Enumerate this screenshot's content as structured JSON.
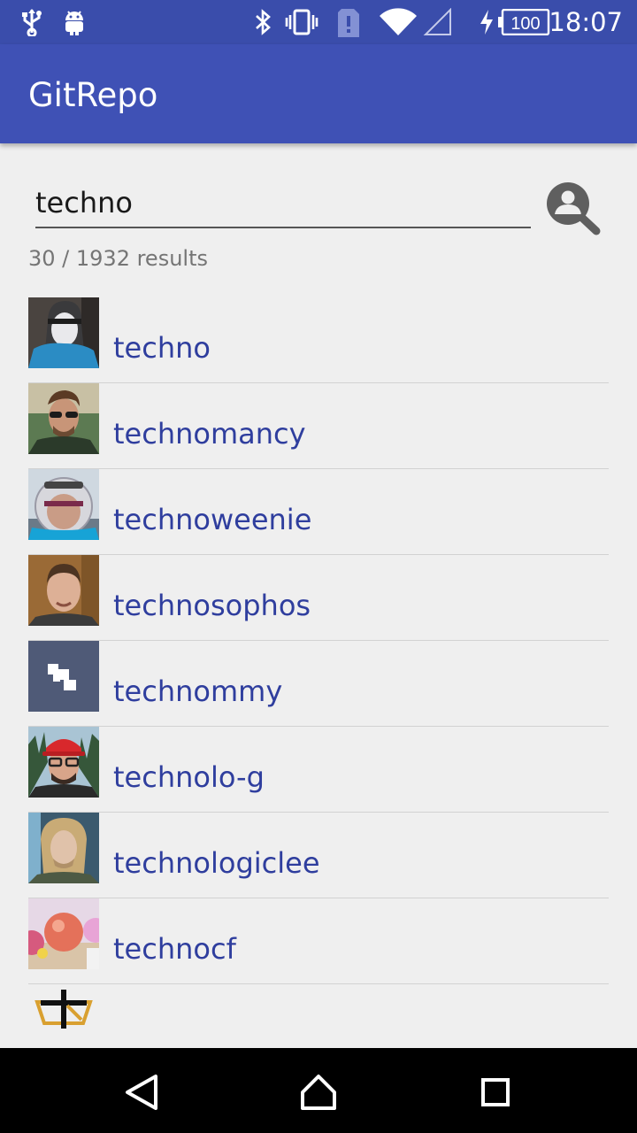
{
  "status_bar": {
    "battery": "100",
    "time": "18:07"
  },
  "app_bar": {
    "title": "GitRepo"
  },
  "search": {
    "query": "techno",
    "icon": "search-user-icon"
  },
  "results": {
    "count_text": "30 / 1932 results",
    "items": [
      {
        "login": "techno"
      },
      {
        "login": "technomancy"
      },
      {
        "login": "technoweenie"
      },
      {
        "login": "technosophos"
      },
      {
        "login": "technommy"
      },
      {
        "login": "technolo-g"
      },
      {
        "login": "technologiclee"
      },
      {
        "login": "technocf"
      },
      {
        "login": ""
      }
    ]
  },
  "colors": {
    "status_bar": "#3a4dab",
    "app_bar": "#3f51b5",
    "link_text": "#2f3e9e",
    "background": "#efefef"
  }
}
